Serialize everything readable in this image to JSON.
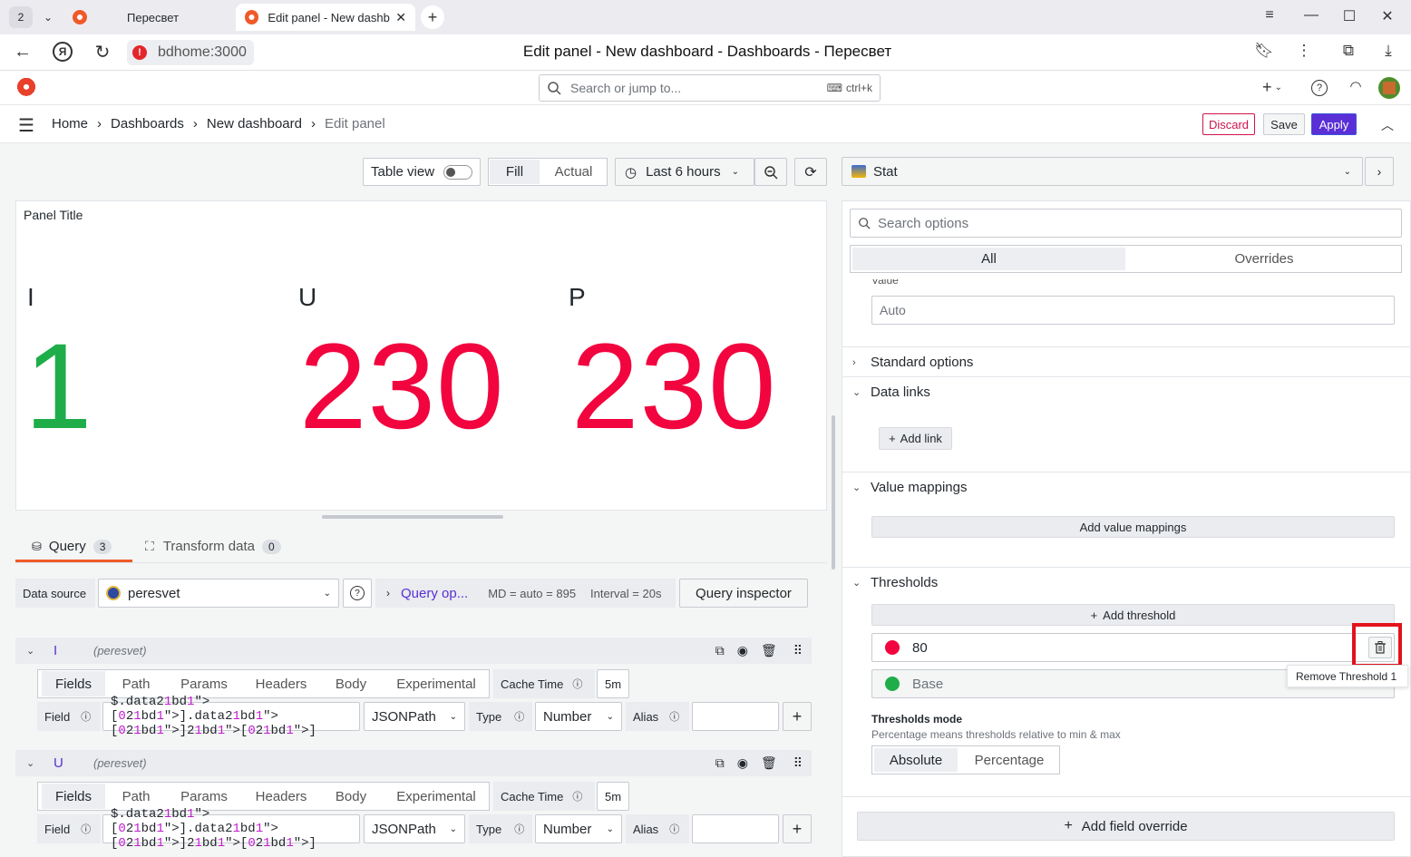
{
  "browser": {
    "tab_count": "2",
    "tabs": [
      {
        "label": "Пересвет"
      },
      {
        "label": "Edit panel - New dashb"
      }
    ],
    "url": "bdhome:3000",
    "page_title": "Edit panel - New dashboard - Dashboards - Пересвет"
  },
  "topbar": {
    "search_placeholder": "Search or jump to...",
    "shortcut": "ctrl+k"
  },
  "breadcrumb": [
    "Home",
    "Dashboards",
    "New dashboard",
    "Edit panel"
  ],
  "actions": {
    "discard": "Discard",
    "save": "Save",
    "apply": "Apply"
  },
  "toolbar": {
    "table_view": "Table view",
    "fill": "Fill",
    "actual": "Actual",
    "time_range": "Last 6 hours"
  },
  "panel": {
    "title": "Panel Title",
    "stats": [
      {
        "label": "I",
        "value": "1",
        "color": "#1fad4a"
      },
      {
        "label": "U",
        "value": "230",
        "color": "#f2043e"
      },
      {
        "label": "P",
        "value": "230",
        "color": "#f2043e"
      }
    ]
  },
  "query_tabs": {
    "query": "Query",
    "query_count": "3",
    "transform": "Transform data",
    "transform_count": "0"
  },
  "datasource": {
    "label": "Data source",
    "value": "peresvet",
    "query_options": "Query op...",
    "md": "MD = auto = 895",
    "interval": "Interval = 20s",
    "inspector": "Query inspector"
  },
  "queries": [
    {
      "name": "I",
      "source": "(peresvet)",
      "tabs": [
        "Fields",
        "Path",
        "Params",
        "Headers",
        "Body",
        "Experimental"
      ],
      "cache_label": "Cache Time",
      "cache_value": "5m",
      "field_label": "Field",
      "field_value": "$.data[0].data[0][0]",
      "parser": "JSONPath",
      "type_label": "Type",
      "type_value": "Number",
      "alias_label": "Alias"
    },
    {
      "name": "U",
      "source": "(peresvet)",
      "tabs": [
        "Fields",
        "Path",
        "Params",
        "Headers",
        "Body",
        "Experimental"
      ],
      "cache_label": "Cache Time",
      "cache_value": "5m",
      "field_label": "Field",
      "field_value": "$.data[0].data[0][0]",
      "parser": "JSONPath",
      "type_label": "Type",
      "type_value": "Number",
      "alias_label": "Alias"
    }
  ],
  "options": {
    "viz": "Stat",
    "search_placeholder": "Search options",
    "tab_all": "All",
    "tab_overrides": "Overrides",
    "value_label": "Value",
    "value_input": "Auto",
    "standard": "Standard options",
    "data_links": "Data links",
    "add_link": "Add link",
    "value_mappings": "Value mappings",
    "add_value_mappings": "Add value mappings",
    "thresholds": "Thresholds",
    "add_threshold": "Add threshold",
    "threshold_values": [
      {
        "value": "80",
        "color": "#f2043e"
      },
      {
        "value": "Base",
        "color": "#1fad4a"
      }
    ],
    "tooltip": "Remove Threshold 1",
    "mode_title": "Thresholds mode",
    "mode_desc": "Percentage means thresholds relative to min & max",
    "mode_absolute": "Absolute",
    "mode_percentage": "Percentage",
    "add_override": "Add field override"
  }
}
